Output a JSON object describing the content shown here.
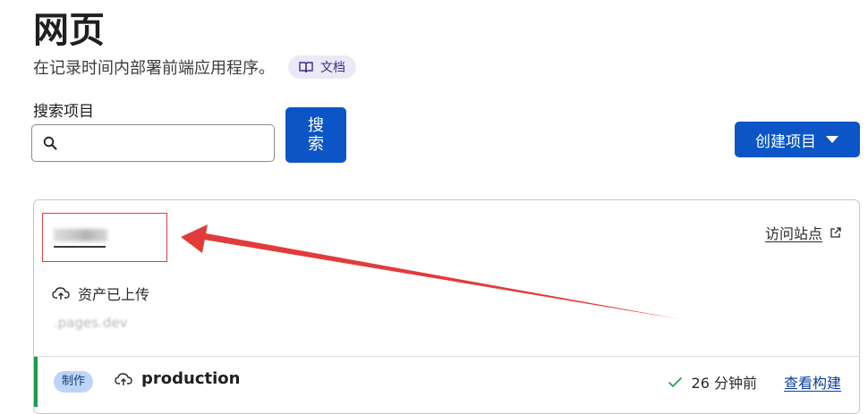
{
  "page": {
    "title": "网页",
    "subtitle": "在记录时间内部署前端应用程序。",
    "docs_label": "文档"
  },
  "search": {
    "label": "搜索项目",
    "value": "",
    "placeholder": "",
    "button_label": "搜索"
  },
  "create_project": {
    "label": "创建项目"
  },
  "project_card": {
    "visit_label": "访问站点",
    "upload_status": "资产已上传",
    "domain": ".pages.dev",
    "deployment": {
      "environment_badge": "制作",
      "branch": "production",
      "time_ago": "26 分钟前",
      "view_build_label": "查看构建"
    }
  },
  "icons": {
    "search": "search-icon",
    "docs": "book-icon",
    "dropdown": "caret-down-icon",
    "external": "external-link-icon",
    "cloud": "cloud-upload-icon",
    "check": "check-icon"
  },
  "colors": {
    "primary": "#0b55c7",
    "success": "#1a9b4b",
    "annotation": "#e23b3b",
    "badge_bg": "#bcd4f7",
    "docs_pill_bg": "#ece8f6"
  }
}
